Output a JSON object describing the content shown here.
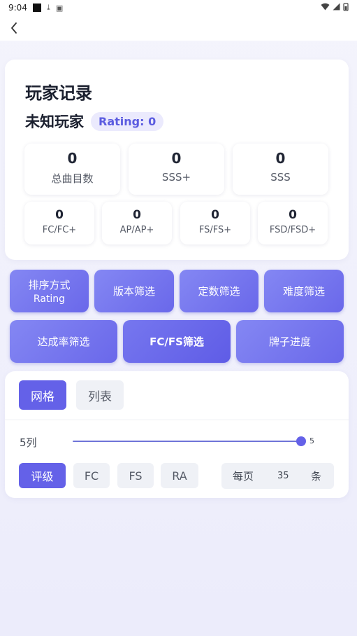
{
  "status_bar": {
    "time": "9:04"
  },
  "player": {
    "title": "玩家记录",
    "name": "未知玩家",
    "rating": "Rating: 0"
  },
  "stats_main": [
    {
      "value": "0",
      "label": "总曲目数"
    },
    {
      "value": "0",
      "label": "SSS+"
    },
    {
      "value": "0",
      "label": "SSS"
    }
  ],
  "stats_fc": [
    {
      "value": "0",
      "label": "FC/FC+"
    },
    {
      "value": "0",
      "label": "AP/AP+"
    },
    {
      "value": "0",
      "label": "FS/FS+"
    },
    {
      "value": "0",
      "label": "FSD/FSD+"
    }
  ],
  "filters_row1": [
    {
      "label": "排序方式",
      "sub": "Rating"
    },
    {
      "label": "版本筛选"
    },
    {
      "label": "定数筛选"
    },
    {
      "label": "难度筛选"
    }
  ],
  "filters_row2": [
    {
      "label": "达成率筛选"
    },
    {
      "label": "FC/FS筛选"
    },
    {
      "label": "牌子进度"
    }
  ],
  "view_tabs": [
    "网格",
    "列表"
  ],
  "columns": {
    "label": "5列",
    "value": "5",
    "fraction": 1.0
  },
  "display_chips": [
    "评级",
    "FC",
    "FS",
    "RA"
  ],
  "page_size": {
    "prefix": "每页",
    "value": "35",
    "suffix": "条"
  },
  "colors": {
    "accent": "#6461e8",
    "chip_bg": "#eff1f6"
  }
}
